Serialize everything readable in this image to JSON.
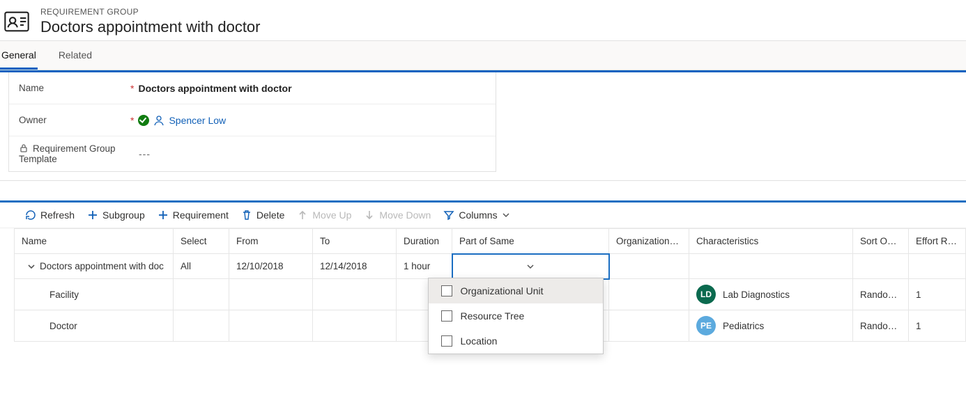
{
  "header": {
    "super": "REQUIREMENT GROUP",
    "title": "Doctors appointment with doctor"
  },
  "tabs": {
    "general": "General",
    "related": "Related"
  },
  "form": {
    "name_label": "Name",
    "name_value": "Doctors appointment with doctor",
    "owner_label": "Owner",
    "owner_value": "Spencer Low",
    "template_label": "Requirement Group Template",
    "template_value": "---"
  },
  "toolbar": {
    "refresh": "Refresh",
    "subgroup": "Subgroup",
    "requirement": "Requirement",
    "delete": "Delete",
    "moveup": "Move Up",
    "movedown": "Move Down",
    "columns": "Columns"
  },
  "columns": {
    "name": "Name",
    "select": "Select",
    "from": "From",
    "to": "To",
    "duration": "Duration",
    "partsame": "Part of Same",
    "orgunit": "Organizational Unit",
    "char": "Characteristics",
    "sort": "Sort Option",
    "effort": "Effort Require"
  },
  "rows": {
    "r0": {
      "name": "Doctors appointment with doc",
      "select": "All",
      "from": "12/10/2018",
      "to": "12/14/2018",
      "duration": "1 hour"
    },
    "r1": {
      "name": "Facility",
      "char_initials": "LD",
      "char_name": "Lab Diagnostics",
      "sort": "Randomize",
      "effort": "1"
    },
    "r2": {
      "name": "Doctor",
      "char_initials": "PE",
      "char_name": "Pediatrics",
      "sort": "Randomize",
      "effort": "1"
    }
  },
  "dropdown": {
    "opt1": "Organizational Unit",
    "opt2": "Resource Tree",
    "opt3": "Location"
  }
}
